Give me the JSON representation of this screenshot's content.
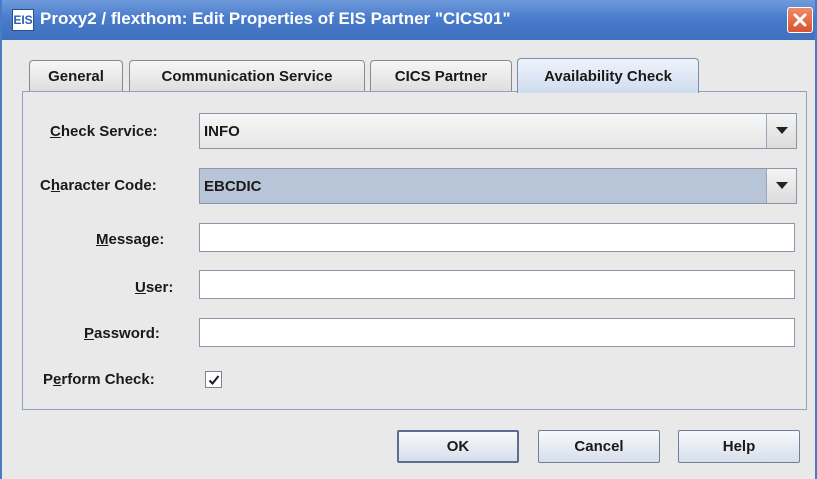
{
  "window": {
    "title": "Proxy2 / flexthom: Edit Properties of EIS Partner \"CICS01\"",
    "app_icon_text": "EIS",
    "close_icon": "close-icon"
  },
  "tabs": [
    {
      "label": "General",
      "active": false
    },
    {
      "label": "Communication Service",
      "active": false
    },
    {
      "label": "CICS Partner",
      "active": false
    },
    {
      "label": "Availability Check",
      "active": true
    }
  ],
  "form": {
    "check_service": {
      "label_mn": "C",
      "label_rest": "heck Service:",
      "value": "INFO"
    },
    "character_code": {
      "label_pre": "C",
      "label_mn": "h",
      "label_rest": "aracter Code:",
      "value": "EBCDIC"
    },
    "message": {
      "label_mn": "M",
      "label_rest": "essage:",
      "value": ""
    },
    "user": {
      "label_mn": "U",
      "label_rest": "ser:",
      "value": ""
    },
    "password": {
      "label_mn": "P",
      "label_rest": "assword:",
      "value": ""
    },
    "perform_check": {
      "label_pre": "P",
      "label_mn": "e",
      "label_rest": "rform Check:",
      "checked": true
    }
  },
  "buttons": {
    "ok": "OK",
    "cancel": "Cancel",
    "help": "Help"
  },
  "colors": {
    "titlebar": "#4a7ccc",
    "selected_combo": "#b8c5d8",
    "close_button": "#d8532e"
  }
}
